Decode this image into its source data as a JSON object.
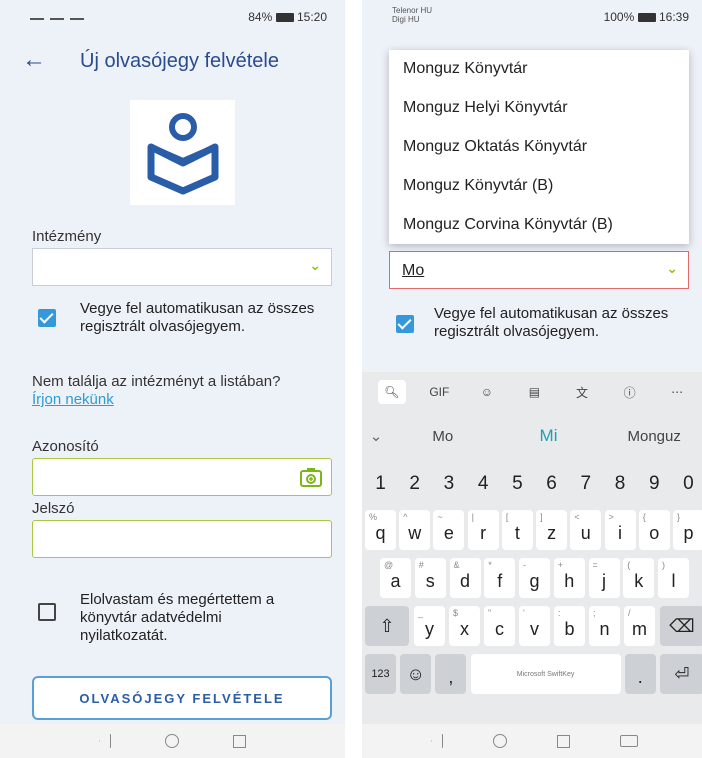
{
  "left": {
    "status_time": "15:20",
    "status_battery": "84%",
    "back_glyph": "←",
    "title": "Új olvasójegy felvétele",
    "institution_label": "Intézmény",
    "auto_add_label": "Vegye fel automatikusan az összes regisztrált olvasójegyem.",
    "missing_text": "Nem találja az intézményt a listában?",
    "write_us_link": "Írjon nekünk",
    "id_label": "Azonosító",
    "password_label": "Jelszó",
    "privacy_label": "Elolvastam és megértettem a könyvtár adatvédelmi nyilatkozatát.",
    "add_button": "OLVASÓJEGY FELVÉTELE"
  },
  "right": {
    "status_time": "16:39",
    "status_battery": "100%",
    "carrier_1": "Telenor HU",
    "carrier_2": "Digi HU",
    "dropdown_options": [
      "Monguz Könyvtár",
      "Monguz Helyi Könyvtár",
      "Monguz Oktatás Könyvtár",
      "Monguz Könyvtár (B)",
      "Monguz Corvina Könyvtár (B)"
    ],
    "select_value": "Mo",
    "auto_add_label": "Vegye fel automatikusan az összes regisztrált olvasójegyem.",
    "keyboard": {
      "suggestions": [
        "Mo",
        "Mi",
        "Monguz"
      ],
      "numbers": [
        "1",
        "2",
        "3",
        "4",
        "5",
        "6",
        "7",
        "8",
        "9",
        "0"
      ],
      "row1": [
        [
          "q",
          "%"
        ],
        [
          "w",
          "^"
        ],
        [
          "e",
          "~"
        ],
        [
          "r",
          "|"
        ],
        [
          "t",
          "["
        ],
        [
          "z",
          "]"
        ],
        [
          "u",
          "<"
        ],
        [
          "i",
          ">"
        ],
        [
          "o",
          "{"
        ],
        [
          "p",
          "}"
        ]
      ],
      "row2": [
        [
          "a",
          "@"
        ],
        [
          "s",
          "#"
        ],
        [
          "d",
          "&"
        ],
        [
          "f",
          "*"
        ],
        [
          "g",
          "-"
        ],
        [
          "h",
          "+"
        ],
        [
          "j",
          "="
        ],
        [
          "k",
          "("
        ],
        [
          "l",
          ")"
        ]
      ],
      "row3": [
        [
          "y",
          "_"
        ],
        [
          "x",
          "$"
        ],
        [
          "c",
          "\""
        ],
        [
          "v",
          "'"
        ],
        [
          "b",
          ":"
        ],
        [
          "n",
          ";"
        ],
        [
          "m",
          "/"
        ]
      ],
      "num_key": "123",
      "space_label": "Microsoft SwiftKey",
      "comma": ",",
      "period": "."
    }
  },
  "icons": [
    "back-arrow-icon",
    "chevron-down-icon",
    "check-icon",
    "camera-icon",
    "search-icon",
    "gif-icon",
    "sticker-icon",
    "clipboard-icon",
    "translate-icon",
    "info-icon",
    "more-icon",
    "shift-icon",
    "backspace-icon",
    "emoji-icon",
    "enter-icon"
  ]
}
